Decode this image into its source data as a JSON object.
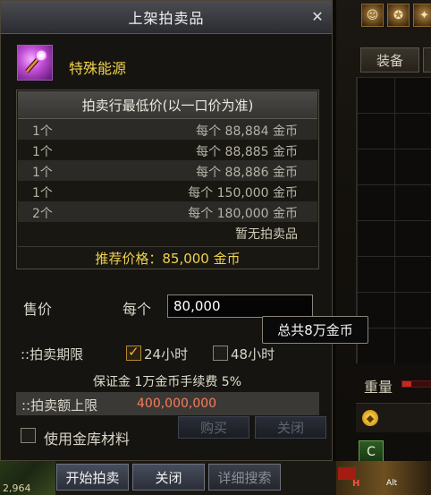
{
  "dialog": {
    "title": "上架拍卖品",
    "close_label": "✕"
  },
  "item": {
    "name": "特殊能源"
  },
  "price_table": {
    "header": "拍卖行最低价(以一口价为准)",
    "rows": [
      {
        "qty": "1个",
        "each": "每个 88,884 金币"
      },
      {
        "qty": "1个",
        "each": "每个 88,885 金币"
      },
      {
        "qty": "1个",
        "each": "每个 88,886 金币"
      },
      {
        "qty": "1个",
        "each": "每个 150,000 金币"
      },
      {
        "qty": "2个",
        "each": "每个 180,000 金币"
      }
    ],
    "no_item": "暂无拍卖品",
    "recommend": "推荐价格：85,000 金币"
  },
  "sell": {
    "label": "售价",
    "unit_label": "每个",
    "price_value": "80,000",
    "tooltip": "总共8万金币"
  },
  "duration": {
    "label": "::拍卖期限",
    "option_24": "24小时",
    "option_48": "48小时",
    "selected": "24小时"
  },
  "fees": {
    "text": "保证金 1万金币手续费 5%"
  },
  "limit": {
    "label": "::拍卖额上限",
    "value": "400,000,000"
  },
  "ghost_buttons": {
    "buy": "购买",
    "close": "关闭"
  },
  "use_storage": {
    "label": "使用金库材料",
    "checked": false
  },
  "buttons": {
    "start": "开始拍卖",
    "close": "关闭",
    "search": "详细搜索"
  },
  "side_panel": {
    "equip_tab": "装备",
    "weight_label": "重量",
    "hotkey_h": "H",
    "hotkey_alt": "Alt",
    "scene_number": "2,964"
  },
  "colors": {
    "accent_gold": "#f1d24c",
    "limit_red": "#ff7a5a",
    "title_bar": "#3b3c41"
  }
}
